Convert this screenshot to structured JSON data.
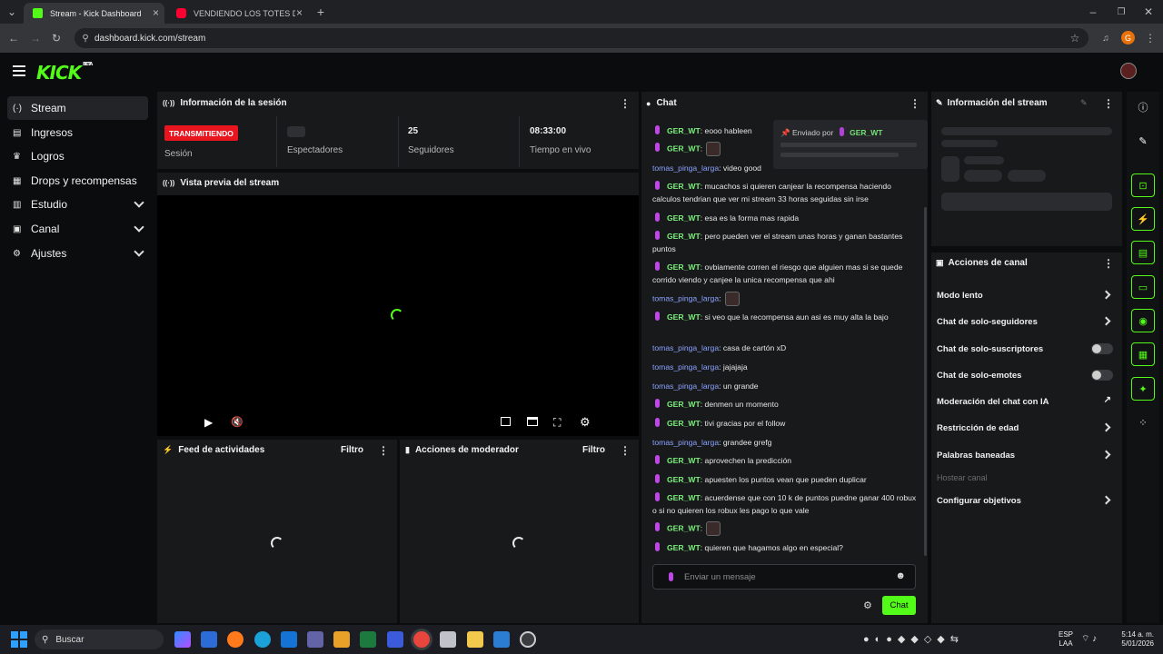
{
  "browser": {
    "tabs": [
      {
        "title": "Stream - Kick Dashboard",
        "favicon_color": "#53fc18"
      },
      {
        "title": "VENDIENDO LOS TOTES DE LOS",
        "favicon_color": "#ff0033"
      }
    ],
    "new_tab": "+",
    "url": "dashboard.kick.com/stream",
    "profile_initial": "G"
  },
  "app": {
    "logo": "KICK",
    "logo_badge": "BETA"
  },
  "sidebar": {
    "items": [
      {
        "label": "Stream",
        "icon": "broadcast-icon",
        "glyph": "(·)"
      },
      {
        "label": "Ingresos",
        "icon": "bank-icon",
        "glyph": "▤"
      },
      {
        "label": "Logros",
        "icon": "trophy-icon",
        "glyph": "🏆"
      },
      {
        "label": "Drops y recompensas",
        "icon": "gift-icon",
        "glyph": "▦"
      },
      {
        "label": "Estudio",
        "icon": "studio-icon",
        "glyph": "▥"
      },
      {
        "label": "Canal",
        "icon": "channel-icon",
        "glyph": "▣"
      },
      {
        "label": "Ajustes",
        "icon": "gear-icon",
        "glyph": "⚙"
      }
    ]
  },
  "session": {
    "title": "Información de la sesión",
    "status_badge": "TRANSMITIENDO",
    "status_label": "Sesión",
    "viewers_label": "Espectadores",
    "followers_value": "25",
    "followers_label": "Seguidores",
    "live_time_value": "08:33:00",
    "live_time_label": "Tiempo en vivo"
  },
  "preview": {
    "title": "Vista previa del stream"
  },
  "activity": {
    "title": "Feed de actividades",
    "filter": "Filtro"
  },
  "modactions": {
    "title": "Acciones de moderador",
    "filter": "Filtro"
  },
  "chat": {
    "title": "Chat",
    "pinned_label": "Enviado por",
    "pinned_user": "GER_WT",
    "messages": [
      {
        "user": "GER_WT",
        "text": ": eooo hableen",
        "type": "ger"
      },
      {
        "user": "GER_WT",
        "text": ":",
        "type": "ger",
        "emote": true
      },
      {
        "user": "tomas_pinga_larga",
        "text": ": video good",
        "type": "tom"
      },
      {
        "user": "GER_WT",
        "text": ": mucachos si quieren canjear la recompensa haciendo calculos tendrian que ver mi stream 33 horas seguidas sin irse",
        "type": "ger"
      },
      {
        "user": "GER_WT",
        "text": ": esa es la forma mas rapida",
        "type": "ger"
      },
      {
        "user": "GER_WT",
        "text": ": pero pueden ver el stream unas horas y ganan bastantes puntos",
        "type": "ger"
      },
      {
        "user": "GER_WT",
        "text": ": ovbiamente corren el riesgo que alguien mas si se quede corrido viendo y canjee la unica recompensa que ahi",
        "type": "ger"
      },
      {
        "user": "tomas_pinga_larga",
        "text": ":",
        "type": "tom",
        "emote": true
      },
      {
        "user": "GER_WT",
        "text": ": si veo que la recompensa aun asi es muy alta la bajo",
        "type": "ger"
      },
      {
        "user": "tomas_pinga_larga",
        "text": ": casa de cartón xD",
        "type": "tom"
      },
      {
        "user": "tomas_pinga_larga",
        "text": ": jajajaja",
        "type": "tom"
      },
      {
        "user": "tomas_pinga_larga",
        "text": ": un grande",
        "type": "tom"
      },
      {
        "user": "GER_WT",
        "text": ": denmen un momento",
        "type": "ger"
      },
      {
        "user": "GER_WT",
        "text": ": tivi gracias por el follow",
        "type": "ger"
      },
      {
        "user": "tomas_pinga_larga",
        "text": ": grandee grefg",
        "type": "tom"
      },
      {
        "user": "GER_WT",
        "text": ": aprovechen la predicción",
        "type": "ger"
      },
      {
        "user": "GER_WT",
        "text": ": apuesten los puntos vean que pueden duplicar",
        "type": "ger"
      },
      {
        "user": "GER_WT",
        "text": ": acuerdense que con 10 k de puntos puedne ganar 400 robux o si no quieren los robux les pago lo que vale",
        "type": "ger"
      },
      {
        "user": "GER_WT",
        "text": ":",
        "type": "ger",
        "emote": true
      },
      {
        "user": "GER_WT",
        "text": ": quieren que hagamos algo en especial?",
        "type": "ger"
      }
    ],
    "input_placeholder": "Enviar un mensaje",
    "send_button": "Chat"
  },
  "stream_info": {
    "title": "Información del stream"
  },
  "channel_actions": {
    "title": "Acciones de canal",
    "items": [
      {
        "label": "Modo lento",
        "control": "chevron"
      },
      {
        "label": "Chat de solo-seguidores",
        "control": "chevron"
      },
      {
        "label": "Chat de solo-suscriptores",
        "control": "toggle"
      },
      {
        "label": "Chat de solo-emotes",
        "control": "toggle"
      },
      {
        "label": "Moderación del chat con IA",
        "control": "external"
      },
      {
        "label": "Restricción de edad",
        "control": "chevron"
      },
      {
        "label": "Palabras baneadas",
        "control": "chevron"
      },
      {
        "label": "Hostear canal",
        "control": "disabled"
      },
      {
        "label": "Configurar objetivos",
        "control": "chevron"
      }
    ]
  },
  "taskbar": {
    "search": "Buscar",
    "lang": "ESP",
    "lang2": "LAA",
    "time": "5:14 a. m.",
    "date": "5/01/2026"
  },
  "colors": {
    "kick_green": "#53fc18",
    "live_red": "#e8141e"
  }
}
